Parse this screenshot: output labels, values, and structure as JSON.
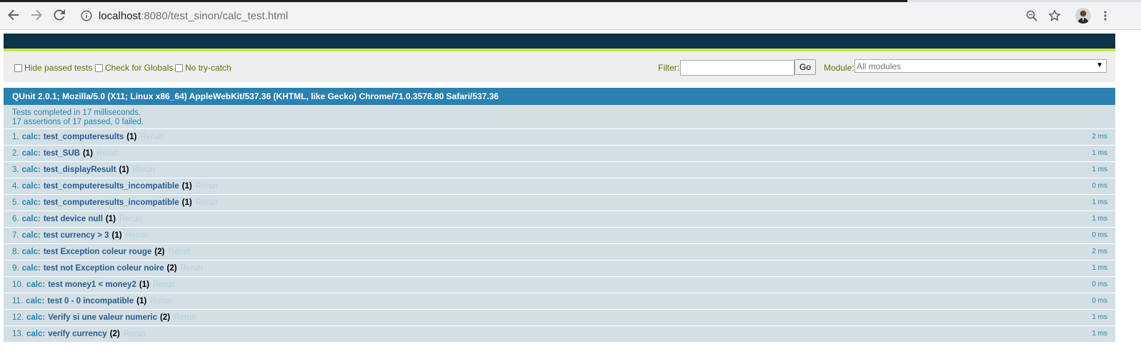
{
  "browser": {
    "url_host": "localhost",
    "url_rest": ":8080/test_sinon/calc_test.html",
    "icons": [
      "back-icon",
      "forward-icon",
      "reload-icon",
      "info-icon",
      "zoom-icon",
      "star-icon",
      "menu-icon"
    ]
  },
  "toolbar": {
    "hide_passed": "Hide passed tests",
    "check_globals": "Check for Globals",
    "no_try_catch": "No try-catch",
    "filter_label": "Filter:",
    "filter_value": "",
    "go_label": "Go",
    "module_label": "Module:",
    "module_value": "All modules",
    "module_arrow": "▼"
  },
  "useragent": "QUnit 2.0.1; Mozilla/5.0 (X11; Linux x86_64) AppleWebKit/537.36 (KHTML, like Gecko) Chrome/71.0.3578.80 Safari/537.36",
  "results": {
    "line1": "Tests completed in 17 milliseconds.",
    "line2": "17 assertions of 17 passed, 0 failed."
  },
  "tests": [
    {
      "num": "1.",
      "module": "calc:",
      "name": "test_computeresults",
      "count": "(1)",
      "rerun": "Rerun",
      "ms": "2 ms"
    },
    {
      "num": "2.",
      "module": "calc:",
      "name": "test_SUB",
      "count": "(1)",
      "rerun": "Rerun",
      "ms": "1 ms"
    },
    {
      "num": "3.",
      "module": "calc:",
      "name": "test_displayResult",
      "count": "(1)",
      "rerun": "Rerun",
      "ms": "1 ms"
    },
    {
      "num": "4.",
      "module": "calc:",
      "name": "test_computeresults_incompatible",
      "count": "(1)",
      "rerun": "Rerun",
      "ms": "0 ms"
    },
    {
      "num": "5.",
      "module": "calc:",
      "name": "test_computeresults_incompatible",
      "count": "(1)",
      "rerun": "Rerun",
      "ms": "1 ms"
    },
    {
      "num": "6.",
      "module": "calc:",
      "name": "test device null",
      "count": "(1)",
      "rerun": "Rerun",
      "ms": "1 ms"
    },
    {
      "num": "7.",
      "module": "calc:",
      "name": "test currency > 3",
      "count": "(1)",
      "rerun": "Rerun",
      "ms": "0 ms"
    },
    {
      "num": "8.",
      "module": "calc:",
      "name": "test Exception coleur rouge",
      "count": "(2)",
      "rerun": "Rerun",
      "ms": "2 ms"
    },
    {
      "num": "9.",
      "module": "calc:",
      "name": "test not Exception coleur noire",
      "count": "(2)",
      "rerun": "Rerun",
      "ms": "1 ms"
    },
    {
      "num": "10.",
      "module": "calc:",
      "name": "test money1 < money2",
      "count": "(1)",
      "rerun": "Rerun",
      "ms": "0 ms"
    },
    {
      "num": "11.",
      "module": "calc:",
      "name": "test 0 - 0 incompatible",
      "count": "(1)",
      "rerun": "Rerun",
      "ms": "0 ms"
    },
    {
      "num": "12.",
      "module": "calc:",
      "name": "Verify si une valeur numeric",
      "count": "(2)",
      "rerun": "Rerun",
      "ms": "1 ms"
    },
    {
      "num": "13.",
      "module": "calc:",
      "name": "verify currency",
      "count": "(2)",
      "rerun": "Rerun",
      "ms": "1 ms"
    }
  ]
}
